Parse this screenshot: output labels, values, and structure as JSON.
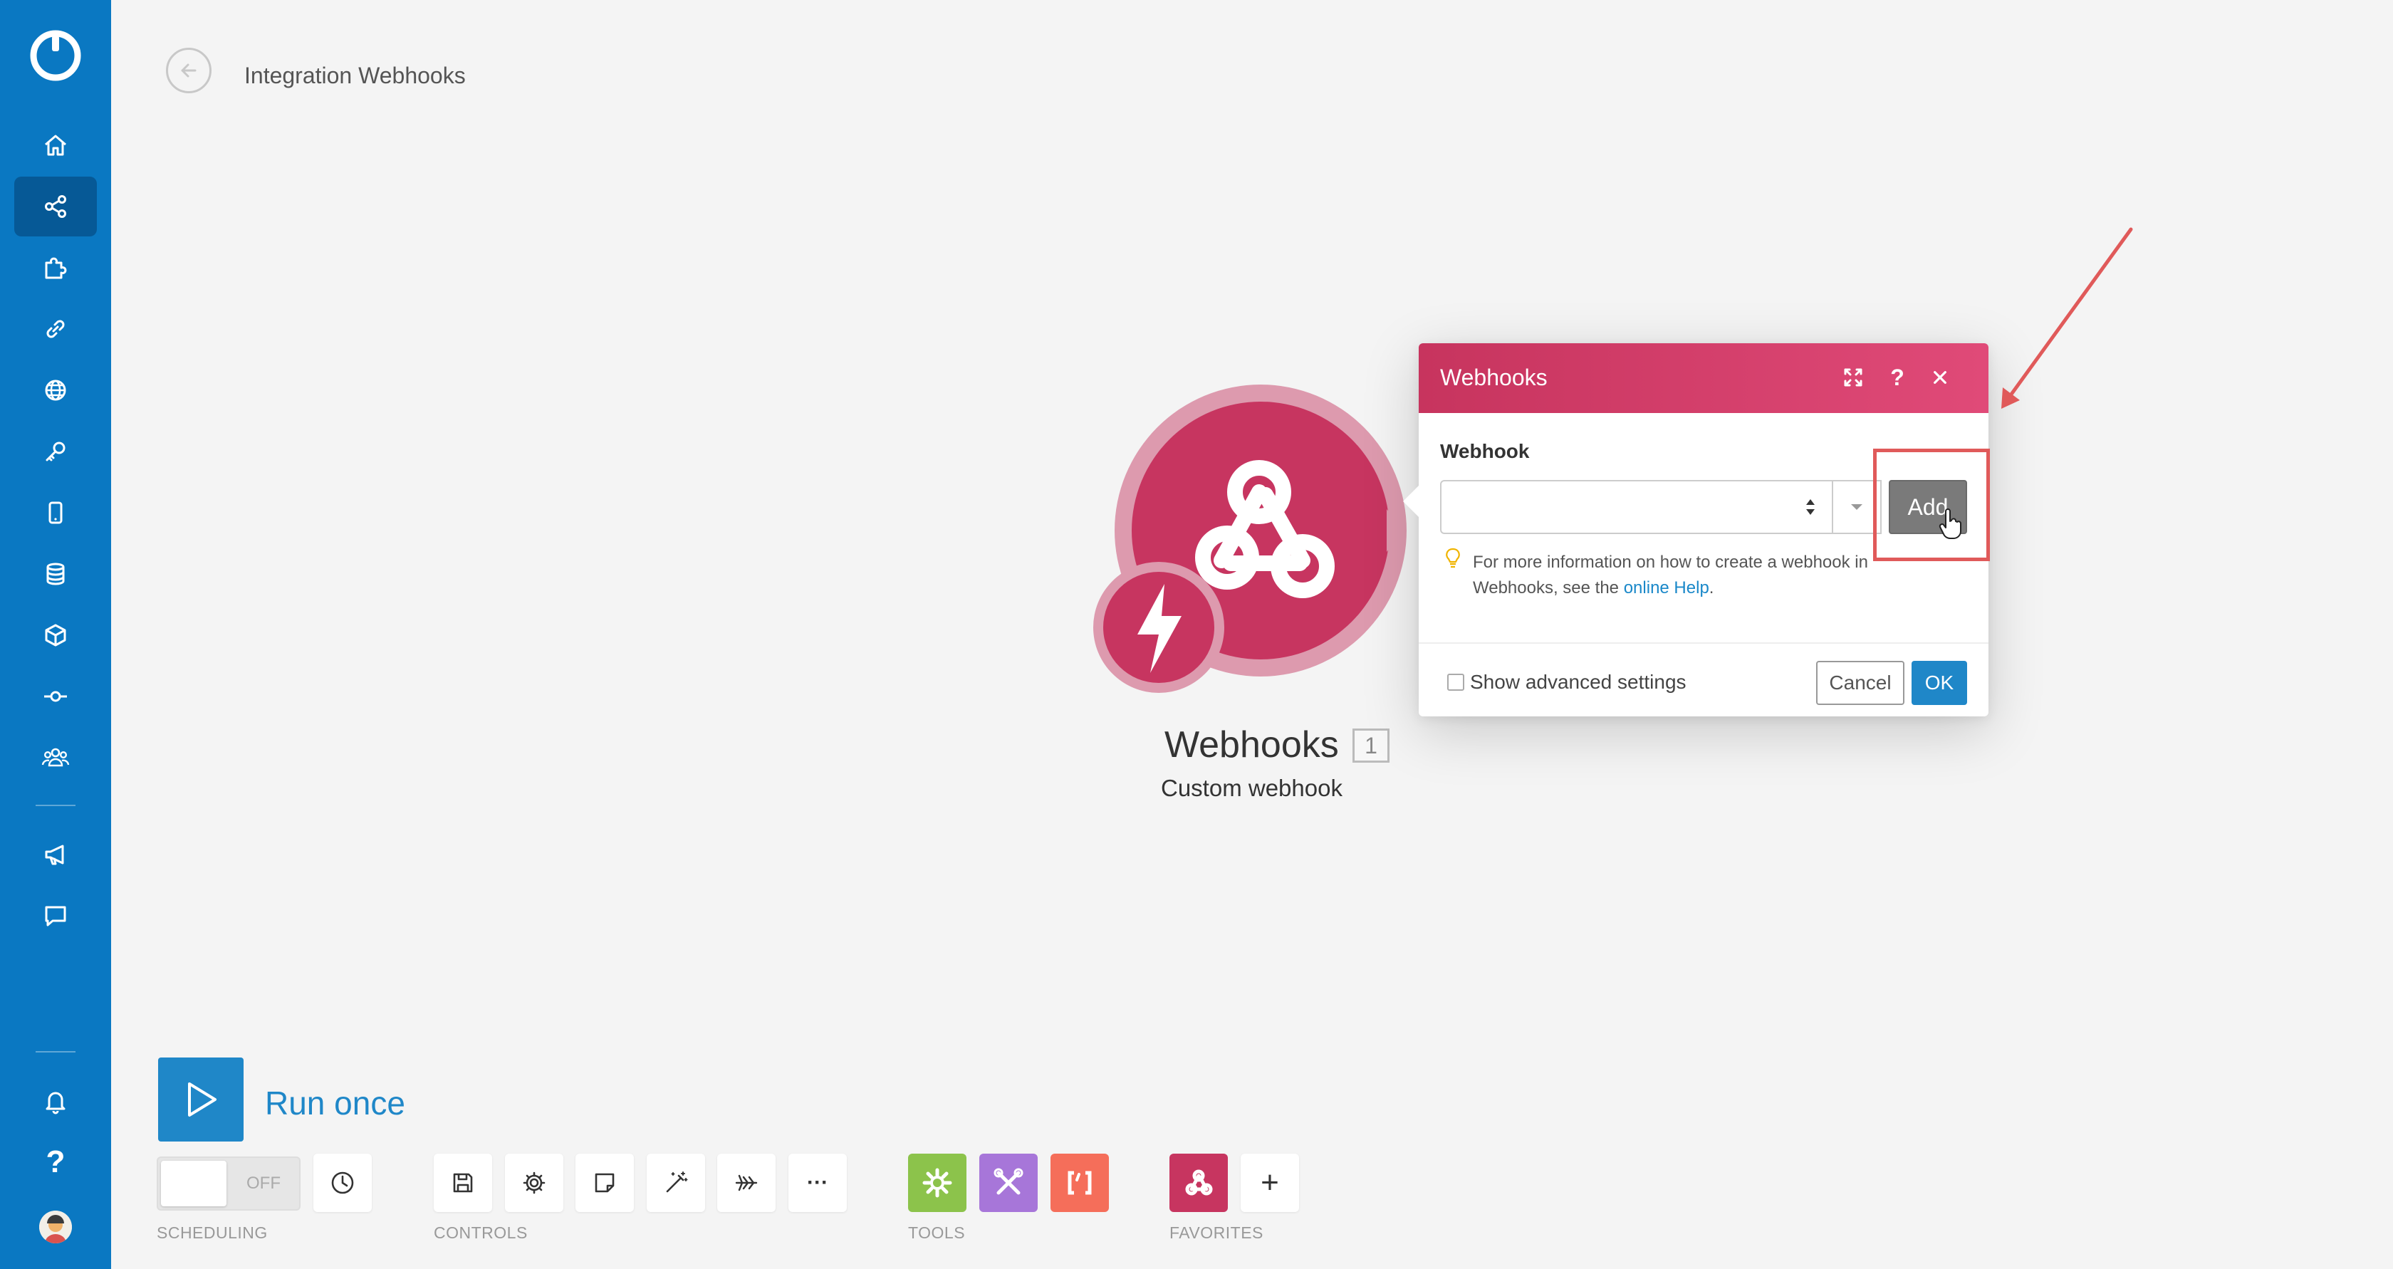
{
  "header": {
    "title": "Integration Webhooks"
  },
  "sidebar": {
    "items": [
      {
        "icon": "home-icon"
      },
      {
        "icon": "share-icon",
        "active": true
      },
      {
        "icon": "puzzle-icon"
      },
      {
        "icon": "link-icon"
      },
      {
        "icon": "globe-icon"
      },
      {
        "icon": "key-icon"
      },
      {
        "icon": "mobile-icon"
      },
      {
        "icon": "database-icon"
      },
      {
        "icon": "cube-icon"
      },
      {
        "icon": "commit-icon"
      },
      {
        "icon": "team-icon"
      }
    ],
    "lower_items": [
      {
        "icon": "megaphone-icon"
      },
      {
        "icon": "chat-icon"
      }
    ],
    "bottom_items": [
      {
        "icon": "bell-icon"
      },
      {
        "icon": "help-icon",
        "glyph": "?"
      },
      {
        "icon": "avatar-icon"
      }
    ]
  },
  "module": {
    "name": "Webhooks",
    "count": "1",
    "subtitle": "Custom webhook",
    "color": "#c73560"
  },
  "dialog": {
    "title": "Webhooks",
    "field_label": "Webhook",
    "select_value": "",
    "add_label": "Add",
    "hint_text": "For more information on how to create a webhook in Webhooks, see the",
    "hint_link": "online Help",
    "hint_end": ".",
    "advanced_label": "Show advanced settings",
    "advanced_checked": false,
    "cancel_label": "Cancel",
    "ok_label": "OK"
  },
  "toolbar": {
    "run_label": "Run once",
    "schedule_state": "OFF",
    "sections": {
      "scheduling": "SCHEDULING",
      "controls": "CONTROLS",
      "tools": "TOOLS",
      "favorites": "FAVORITES"
    },
    "controls": [
      "save-icon",
      "settings-icon",
      "notes-icon",
      "magic-wand-icon",
      "airplane-icon",
      "more-icon"
    ],
    "more_glyph": "···",
    "tools": [
      {
        "icon": "gear-icon",
        "color": "#8cc34b"
      },
      {
        "icon": "tools-icon",
        "color": "#a776d9"
      },
      {
        "icon": "brackets-icon",
        "color": "#f56e5a"
      }
    ],
    "favorites": [
      {
        "icon": "webhooks-icon",
        "color": "#c73560"
      }
    ],
    "add_favorite_glyph": "+"
  },
  "colors": {
    "sidebar": "#0a78c2",
    "accent": "#1f87c8",
    "dialog_header": "#d63d6a",
    "annotation": "#e05a5a"
  }
}
